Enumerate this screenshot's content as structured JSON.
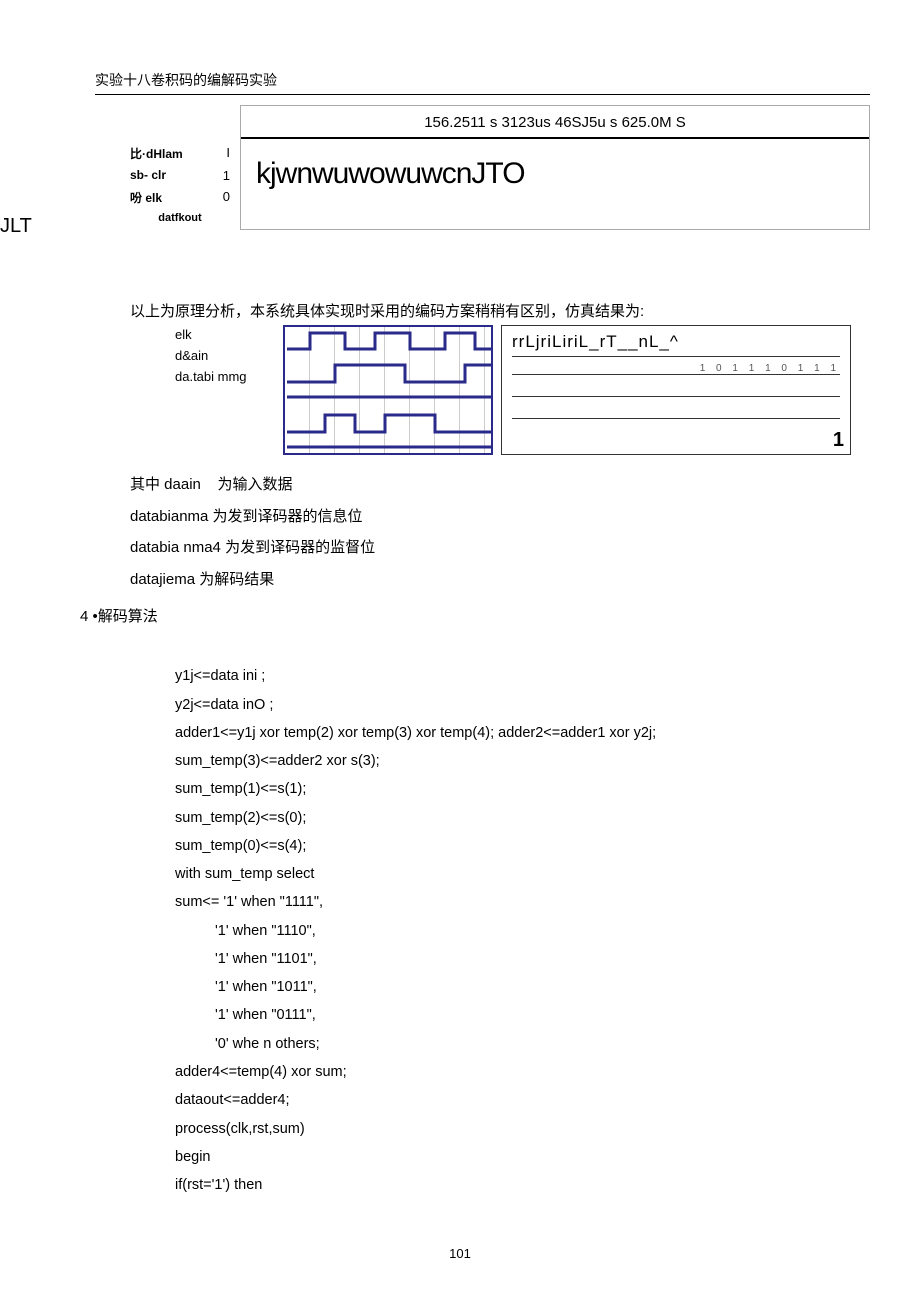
{
  "header": "实验十八卷积码的编解码实验",
  "side_text": "JLT",
  "sim1": {
    "top_text": "156.2511 s 3123us 46SJ5u s 625.0M S",
    "big_text": "kjwnwuwowuwcnJTO",
    "labels": {
      "l1": "比·dHlam",
      "l2": "sb- clr",
      "l3": "吩 elk",
      "l4": "datfkout"
    },
    "vals": {
      "v1": "I",
      "v2": "1",
      "v3": "0"
    }
  },
  "para_intro": "以上为原理分析，本系统具体实现时采用的编码方案稍稍有区别，仿真结果为:",
  "sim2_labels": {
    "l1": "elk",
    "l2": "d&ain",
    "l3": "da.tabi mmg"
  },
  "sim2_right": {
    "row1": "rrLjriLiriL_rT__nL_^",
    "tiny": "1 0 1 1 1 0 1 1 1",
    "one": "1"
  },
  "desc": {
    "d1_a": "其中 daain",
    "d1_b": "为输入数据",
    "d2": "databianma 为发到译码器的信息位",
    "d3": "databia nma4 为发到译码器的监督位",
    "d4": "datajiema 为解码结果"
  },
  "algo_header": "4  •解码算法",
  "code": {
    "c01": "y1j<=data ini ;",
    "c02": "y2j<=data inO ;",
    "c03": "adder1<=y1j xor temp(2) xor temp(3) xor temp(4); adder2<=adder1 xor y2j;",
    "c04": "sum_temp(3)<=adder2 xor s(3);",
    "c05": "sum_temp(1)<=s(1);",
    "c06": "sum_temp(2)<=s(0);",
    "c07": "sum_temp(0)<=s(4);",
    "c08": "with sum_temp select",
    "c09": "sum<= '1' when \"1111\",",
    "c10": "'1' when \"1110\",",
    "c11": "'1' when \"1101\",",
    "c12": "'1' when \"1011\",",
    "c13": "'1' when \"0111\",",
    "c14": "'0' whe n others;",
    "c15": "adder4<=temp(4) xor sum;",
    "c16": "dataout<=adder4;",
    "c17": "process(clk,rst,sum)",
    "c18": "begin",
    "c19": " if(rst='1') then"
  },
  "page_number": "101"
}
